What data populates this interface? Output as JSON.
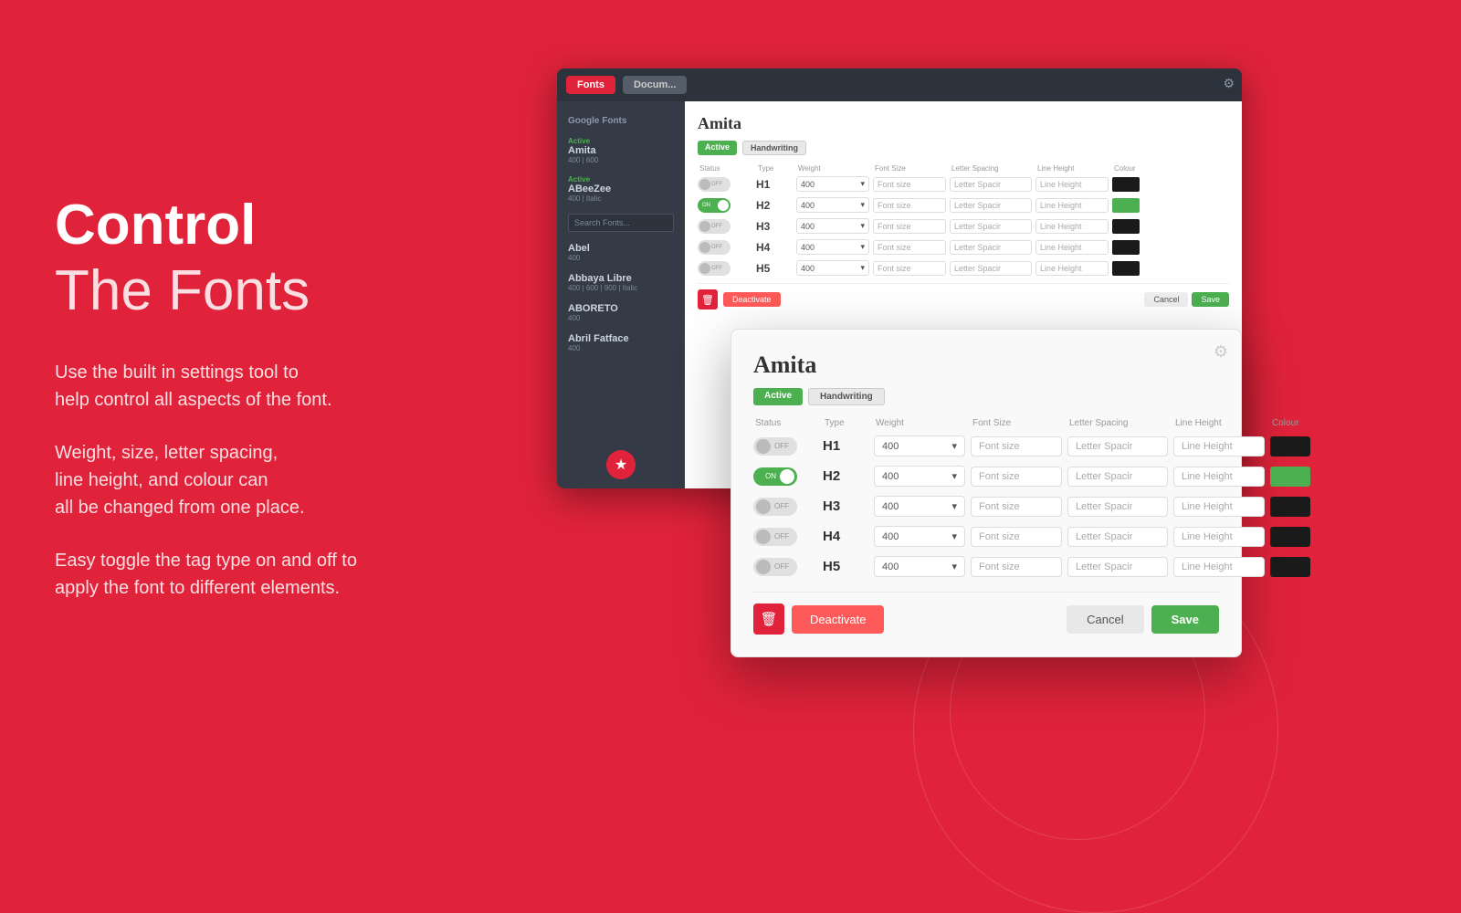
{
  "page": {
    "title_bold": "Control",
    "title_normal": "The Fonts",
    "desc1": "Use the built in settings tool to\nhelp control all aspects of the font.",
    "desc2": "Weight, size, letter spacing,\nline height, and colour can\nall be changed from one place.",
    "desc3": "Easy toggle the tag type on and off to\napply the font to different elements."
  },
  "app_window": {
    "tab1": "Fonts",
    "tab2": "Docum..."
  },
  "sidebar": {
    "section": "Google Fonts",
    "fonts": [
      {
        "status": "Active",
        "name": "Amita",
        "weights": "400 | 600"
      },
      {
        "status": "Active",
        "name": "ABeeZee",
        "weights": "400 | Italic"
      },
      {
        "name": "Abel",
        "weights": "400"
      },
      {
        "name": "Abbaya Libre",
        "weights": "400 | 600 | 900 | Italic"
      },
      {
        "name": "ABORETO",
        "weights": "400"
      },
      {
        "name": "Abril Fatface",
        "weights": "400"
      }
    ],
    "search_placeholder": "Search Fonts..."
  },
  "font_panel_bg": {
    "title": "Amita",
    "badges": [
      "Active",
      "Handwriting"
    ],
    "table_headers": [
      "Status",
      "Type",
      "Weight",
      "Font Size",
      "Letter Spacing",
      "Line Height",
      "Colour"
    ],
    "rows": [
      {
        "toggle": "off",
        "type": "H1",
        "weight": "400",
        "font_size": "Font size",
        "letter_spacing": "Letter Spacir",
        "line_height": "Line Height",
        "color": "black"
      },
      {
        "toggle": "on",
        "type": "H2",
        "weight": "400",
        "font_size": "Font size",
        "letter_spacing": "Letter Spacir",
        "line_height": "Line Height",
        "color": "green"
      },
      {
        "toggle": "off",
        "type": "H3",
        "weight": "400",
        "font_size": "Font size",
        "letter_spacing": "Letter Spacir",
        "line_height": "Line Height",
        "color": "black"
      },
      {
        "toggle": "off",
        "type": "H4",
        "weight": "400",
        "font_size": "Font size",
        "letter_spacing": "Letter Spacir",
        "line_height": "Line Height",
        "color": "black"
      },
      {
        "toggle": "off",
        "type": "H5",
        "weight": "400",
        "font_size": "Font size",
        "letter_spacing": "Letter Spacir",
        "line_height": "Line Height",
        "color": "black"
      }
    ],
    "actions": {
      "delete": "🗑",
      "deactivate": "Deactivate",
      "cancel": "Cancel",
      "save": "Save"
    }
  },
  "font_modal": {
    "title": "Amita",
    "badges": [
      "Active",
      "Handwriting"
    ],
    "table_headers": [
      "Status",
      "Type",
      "Weight",
      "Font Size",
      "Letter Spacing",
      "Line Height",
      "Colour"
    ],
    "rows": [
      {
        "toggle": "off",
        "type": "H1",
        "weight": "400",
        "font_size": "Font size",
        "letter_spacing": "Letter Spacir",
        "line_height": "Line Height",
        "color": "black"
      },
      {
        "toggle": "on",
        "type": "H2",
        "weight": "400",
        "font_size": "Font size",
        "letter_spacing": "Letter Spacir",
        "line_height": "Line Height",
        "color": "green"
      },
      {
        "toggle": "off",
        "type": "H3",
        "weight": "400",
        "font_size": "Font size",
        "letter_spacing": "Letter Spacir",
        "line_height": "Line Height",
        "color": "black"
      },
      {
        "toggle": "off",
        "type": "H4",
        "weight": "400",
        "font_size": "Font size",
        "letter_spacing": "Letter Spacir",
        "line_height": "Line Height",
        "color": "black"
      },
      {
        "toggle": "off",
        "type": "H5",
        "weight": "400",
        "font_size": "Font size",
        "letter_spacing": "Letter Spacir",
        "line_height": "Line Height",
        "color": "black"
      }
    ],
    "actions": {
      "delete": "🗑",
      "deactivate": "Deactivate",
      "cancel": "Cancel",
      "save": "Save"
    }
  }
}
